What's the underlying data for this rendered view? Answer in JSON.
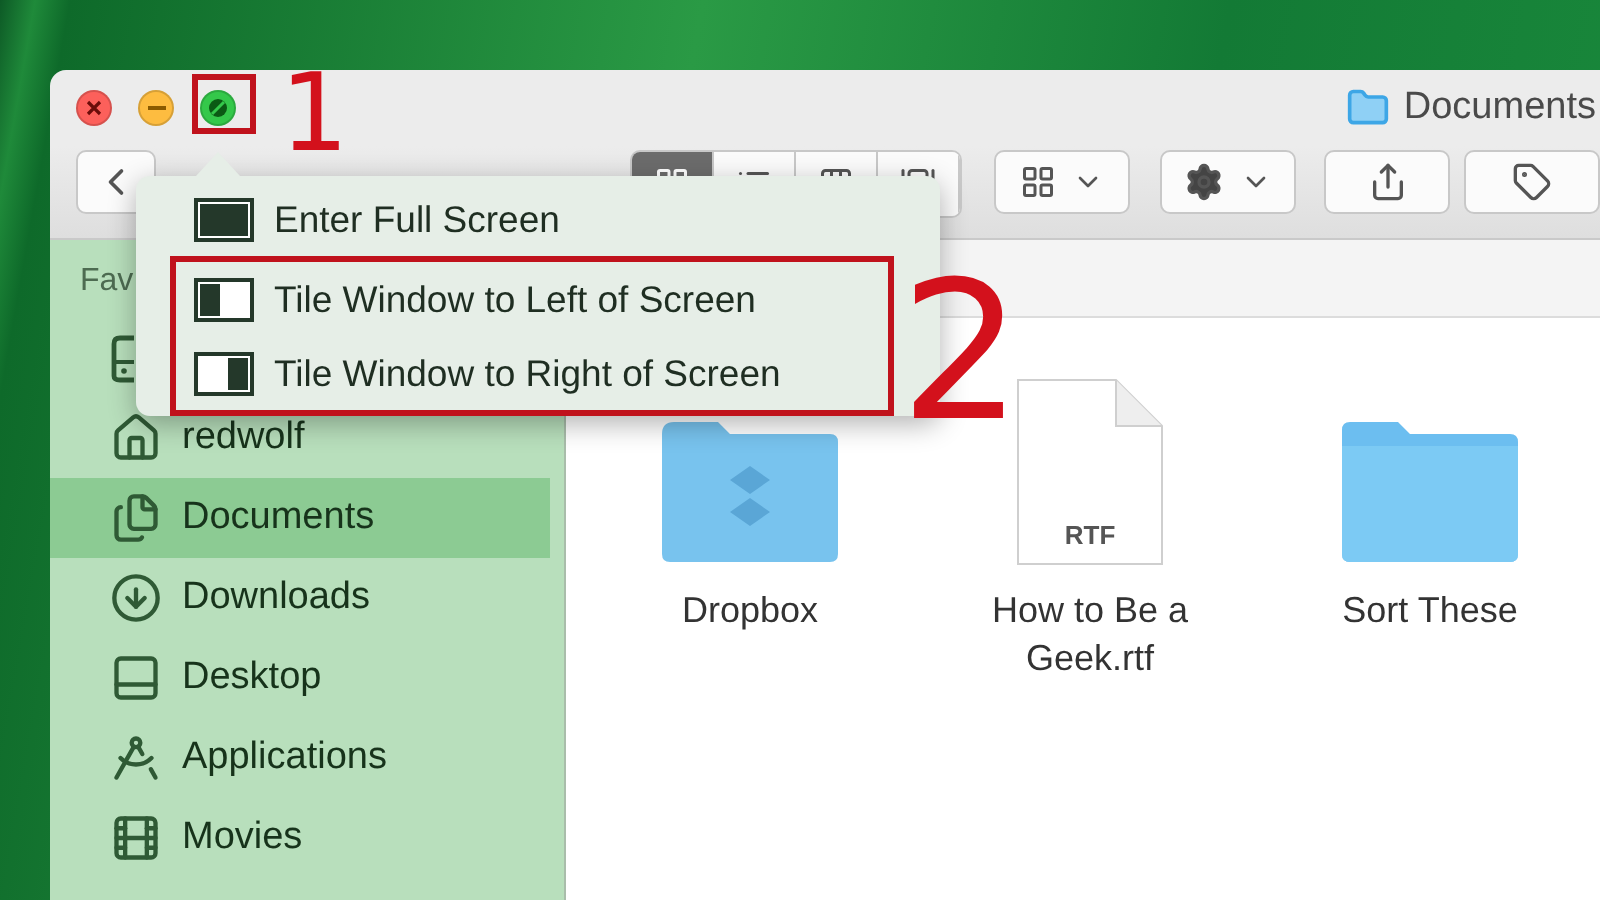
{
  "window": {
    "title": "Documents"
  },
  "toolbar": {
    "view_modes": [
      {
        "selected": true
      },
      {
        "selected": false
      },
      {
        "selected": false
      },
      {
        "selected": false
      }
    ]
  },
  "sidebar": {
    "section": "Fav",
    "items": [
      {
        "selected": false
      },
      {
        "label": "redwolf",
        "selected": false
      },
      {
        "label": "Documents",
        "selected": true
      },
      {
        "label": "Downloads",
        "selected": false
      },
      {
        "label": "Desktop",
        "selected": false
      },
      {
        "label": "Applications",
        "selected": false
      },
      {
        "label": "Movies",
        "selected": false
      }
    ]
  },
  "files": [
    {
      "name": "Dropbox",
      "kind": "dropbox-folder"
    },
    {
      "name": "How to Be a Geek.rtf",
      "kind": "document",
      "badge": "RTF"
    },
    {
      "name": "Sort These",
      "kind": "folder"
    }
  ],
  "popup_menu": {
    "items": [
      {
        "label": "Enter Full Screen",
        "kind": "full",
        "highlighted": false
      },
      {
        "label": "Tile Window to Left of Screen",
        "kind": "left",
        "highlighted": true
      },
      {
        "label": "Tile Window to Right of Screen",
        "kind": "right",
        "highlighted": true
      }
    ]
  },
  "annotations": [
    {
      "label": "1"
    },
    {
      "label": "2"
    }
  ]
}
